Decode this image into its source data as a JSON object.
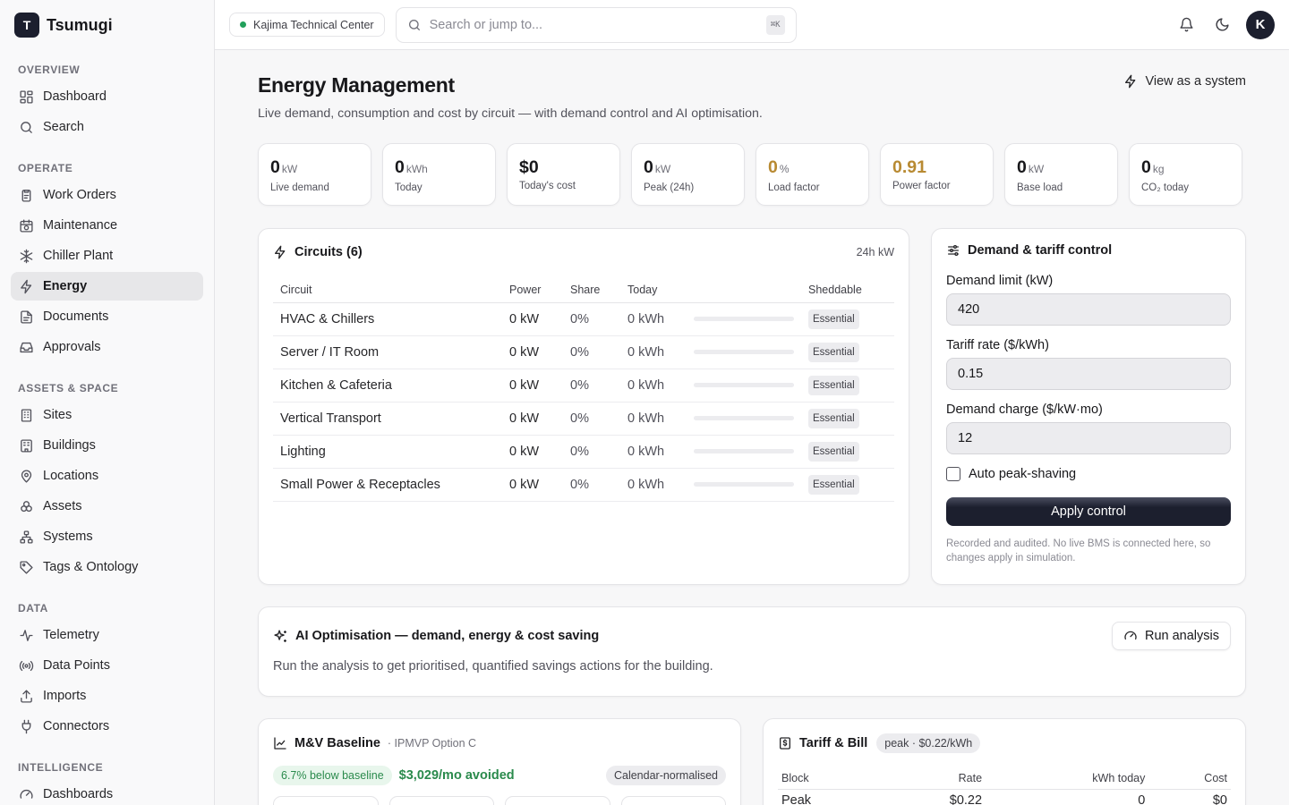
{
  "brand": {
    "logo_letter": "T",
    "name": "Tsumugi"
  },
  "sidebar": {
    "sections": [
      {
        "title": "OVERVIEW",
        "items": [
          {
            "label": "Dashboard",
            "icon": "dashboard-icon"
          },
          {
            "label": "Search",
            "icon": "search-icon"
          }
        ]
      },
      {
        "title": "OPERATE",
        "items": [
          {
            "label": "Work Orders",
            "icon": "clipboard-icon"
          },
          {
            "label": "Maintenance",
            "icon": "calendar-clock-icon"
          },
          {
            "label": "Chiller Plant",
            "icon": "snowflake-icon"
          },
          {
            "label": "Energy",
            "icon": "bolt-icon",
            "active": true
          },
          {
            "label": "Documents",
            "icon": "document-icon"
          },
          {
            "label": "Approvals",
            "icon": "inbox-icon"
          }
        ]
      },
      {
        "title": "ASSETS & SPACE",
        "items": [
          {
            "label": "Sites",
            "icon": "building-icon"
          },
          {
            "label": "Buildings",
            "icon": "office-icon"
          },
          {
            "label": "Locations",
            "icon": "pin-icon"
          },
          {
            "label": "Assets",
            "icon": "boxes-icon"
          },
          {
            "label": "Systems",
            "icon": "network-icon"
          },
          {
            "label": "Tags & Ontology",
            "icon": "tag-icon"
          }
        ]
      },
      {
        "title": "DATA",
        "items": [
          {
            "label": "Telemetry",
            "icon": "activity-icon"
          },
          {
            "label": "Data Points",
            "icon": "radio-icon"
          },
          {
            "label": "Imports",
            "icon": "upload-icon"
          },
          {
            "label": "Connectors",
            "icon": "plug-icon"
          }
        ]
      },
      {
        "title": "INTELLIGENCE",
        "items": [
          {
            "label": "Dashboards",
            "icon": "gauge-icon"
          }
        ]
      }
    ]
  },
  "topbar": {
    "site": "Kajima Technical Center",
    "search_placeholder": "Search or jump to...",
    "shortcut": "⌘K",
    "avatar": "K"
  },
  "page": {
    "title": "Energy Management",
    "subtitle": "Live demand, consumption and cost by circuit — with demand control and AI optimisation.",
    "view_system": "View as a system"
  },
  "kpis": [
    {
      "value": "0",
      "unit": "kW",
      "label": "Live demand"
    },
    {
      "value": "0",
      "unit": "kWh",
      "label": "Today"
    },
    {
      "value": "$0",
      "unit": "",
      "label": "Today's cost"
    },
    {
      "value": "0",
      "unit": "kW",
      "label": "Peak (24h)"
    },
    {
      "value": "0",
      "unit": "%",
      "label": "Load factor",
      "warn": true
    },
    {
      "value": "0.91",
      "unit": "",
      "label": "Power factor",
      "warn": true
    },
    {
      "value": "0",
      "unit": "kW",
      "label": "Base load"
    },
    {
      "value": "0",
      "unit": "kg",
      "label": "CO₂ today"
    }
  ],
  "circuits": {
    "title": "Circuits (6)",
    "meta": "24h kW",
    "columns": [
      "Circuit",
      "Power",
      "Share",
      "Today",
      "",
      "Sheddable"
    ],
    "rows": [
      {
        "name": "HVAC & Chillers",
        "power": "0 kW",
        "share": "0%",
        "today": "0 kWh",
        "fill": 0,
        "tag": "Essential"
      },
      {
        "name": "Server / IT Room",
        "power": "0 kW",
        "share": "0%",
        "today": "0 kWh",
        "fill": 0,
        "tag": "Essential"
      },
      {
        "name": "Kitchen & Cafeteria",
        "power": "0 kW",
        "share": "0%",
        "today": "0 kWh",
        "fill": 0,
        "tag": "Essential"
      },
      {
        "name": "Vertical Transport",
        "power": "0 kW",
        "share": "0%",
        "today": "0 kWh",
        "fill": 0,
        "tag": "Essential"
      },
      {
        "name": "Lighting",
        "power": "0 kW",
        "share": "0%",
        "today": "0 kWh",
        "fill": 0,
        "tag": "Essential"
      },
      {
        "name": "Small Power & Receptacles",
        "power": "0 kW",
        "share": "0%",
        "today": "0 kWh",
        "fill": 0,
        "tag": "Essential"
      }
    ]
  },
  "demand": {
    "title": "Demand & tariff control",
    "limit_label": "Demand limit (kW)",
    "limit_value": "420",
    "tariff_label": "Tariff rate ($/kWh)",
    "tariff_value": "0.15",
    "charge_label": "Demand charge ($/kW·mo)",
    "charge_value": "12",
    "auto_label": "Auto peak-shaving",
    "apply": "Apply control",
    "note": "Recorded and audited. No live BMS is connected here, so changes apply in simulation."
  },
  "ai": {
    "title": "AI Optimisation — demand, energy & cost saving",
    "button": "Run analysis",
    "text": "Run the analysis to get prioritised, quantified savings actions for the building."
  },
  "mv": {
    "title": "M&V Baseline",
    "subtitle": "· IPMVP Option C",
    "below": "6.7% below baseline",
    "avoided": "$3,029/mo avoided",
    "normalised": "Calendar-normalised"
  },
  "tariff": {
    "title": "Tariff & Bill",
    "pill": "peak · $0.22/kWh",
    "columns": [
      "Block",
      "Rate",
      "kWh today",
      "Cost"
    ],
    "rows": [
      {
        "block": "Peak",
        "rate": "$0.22",
        "kwh": "0",
        "cost": "$0"
      }
    ]
  },
  "colors": {
    "accent": "#1c1f2e",
    "warn": "#b88a32",
    "success": "#2a8a4c"
  }
}
